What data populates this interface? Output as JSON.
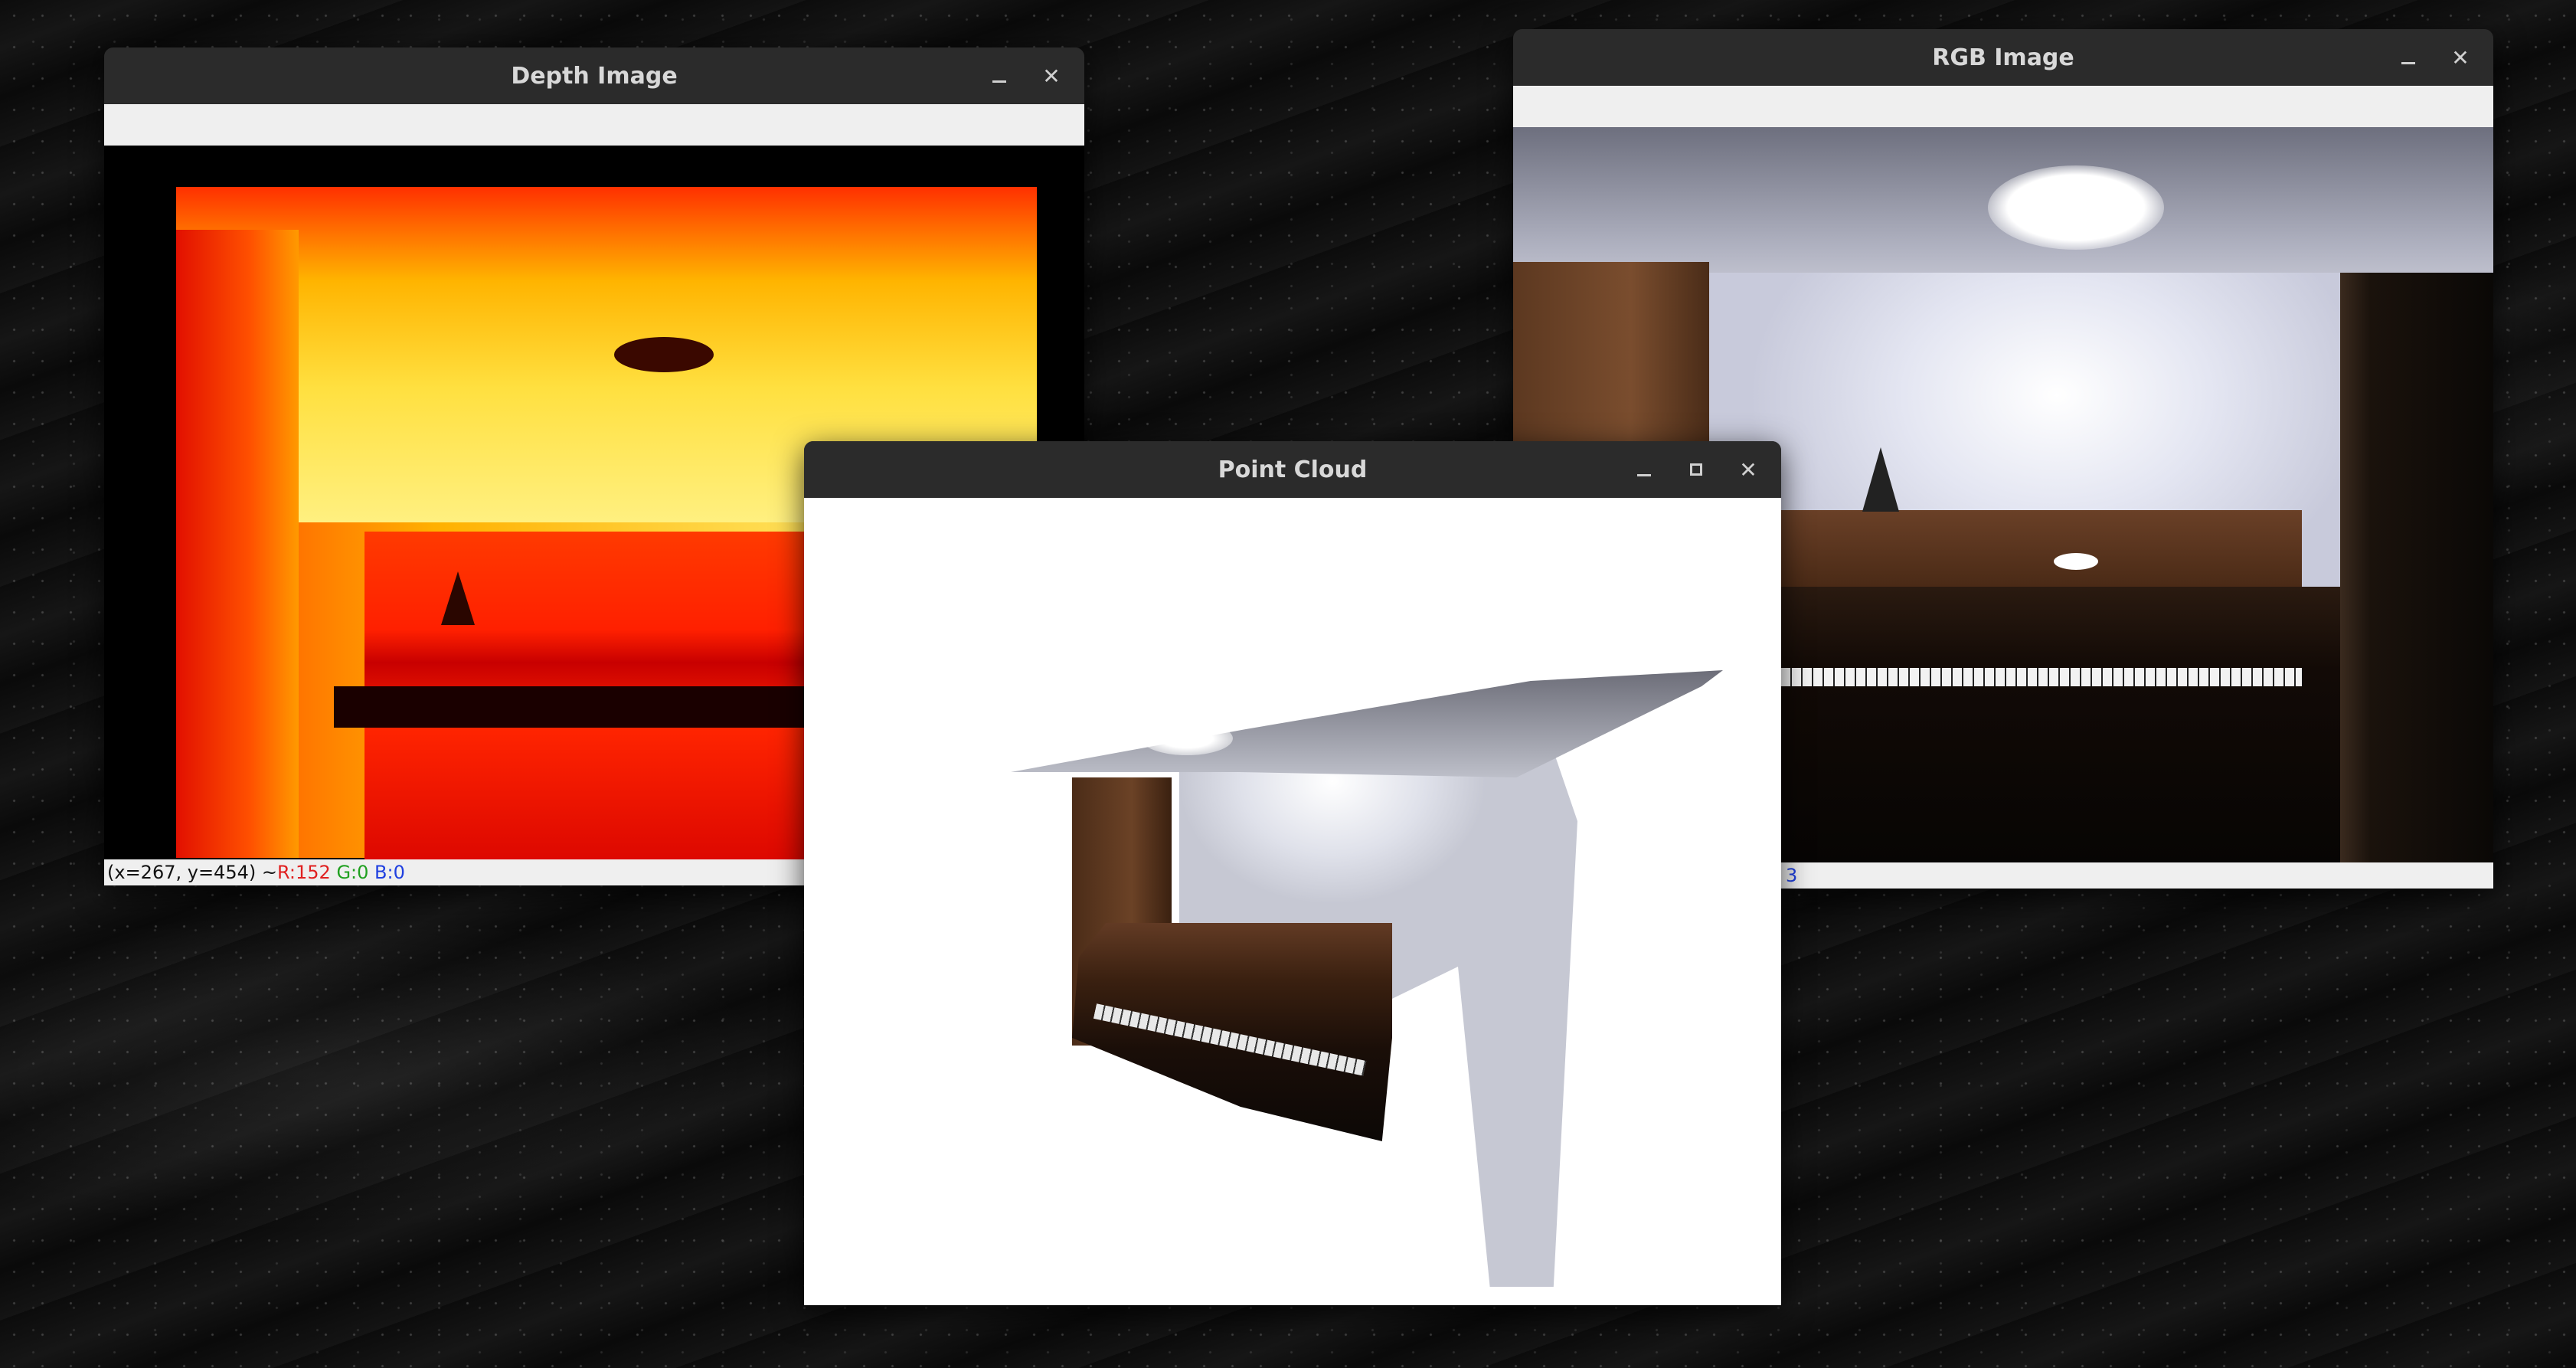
{
  "desktop": {
    "background": "dark sand texture"
  },
  "windows": {
    "depth": {
      "title": "Depth Image",
      "status": {
        "coords": "(x=267, y=454) ~ ",
        "r": "R:152",
        "g": "G:0",
        "b": "B:0"
      }
    },
    "rgb": {
      "title": "RGB Image",
      "status": {
        "partial": "3"
      }
    },
    "point_cloud": {
      "title": "Point Cloud"
    }
  },
  "icons": {
    "minimize": "minimize-icon",
    "maximize": "maximize-icon",
    "close": "close-icon"
  },
  "colors": {
    "titlebar": "#2b2b2b",
    "title_text": "#d8d8d8",
    "status_r": "#e02020",
    "status_g": "#20a020",
    "status_b": "#2040e0"
  }
}
